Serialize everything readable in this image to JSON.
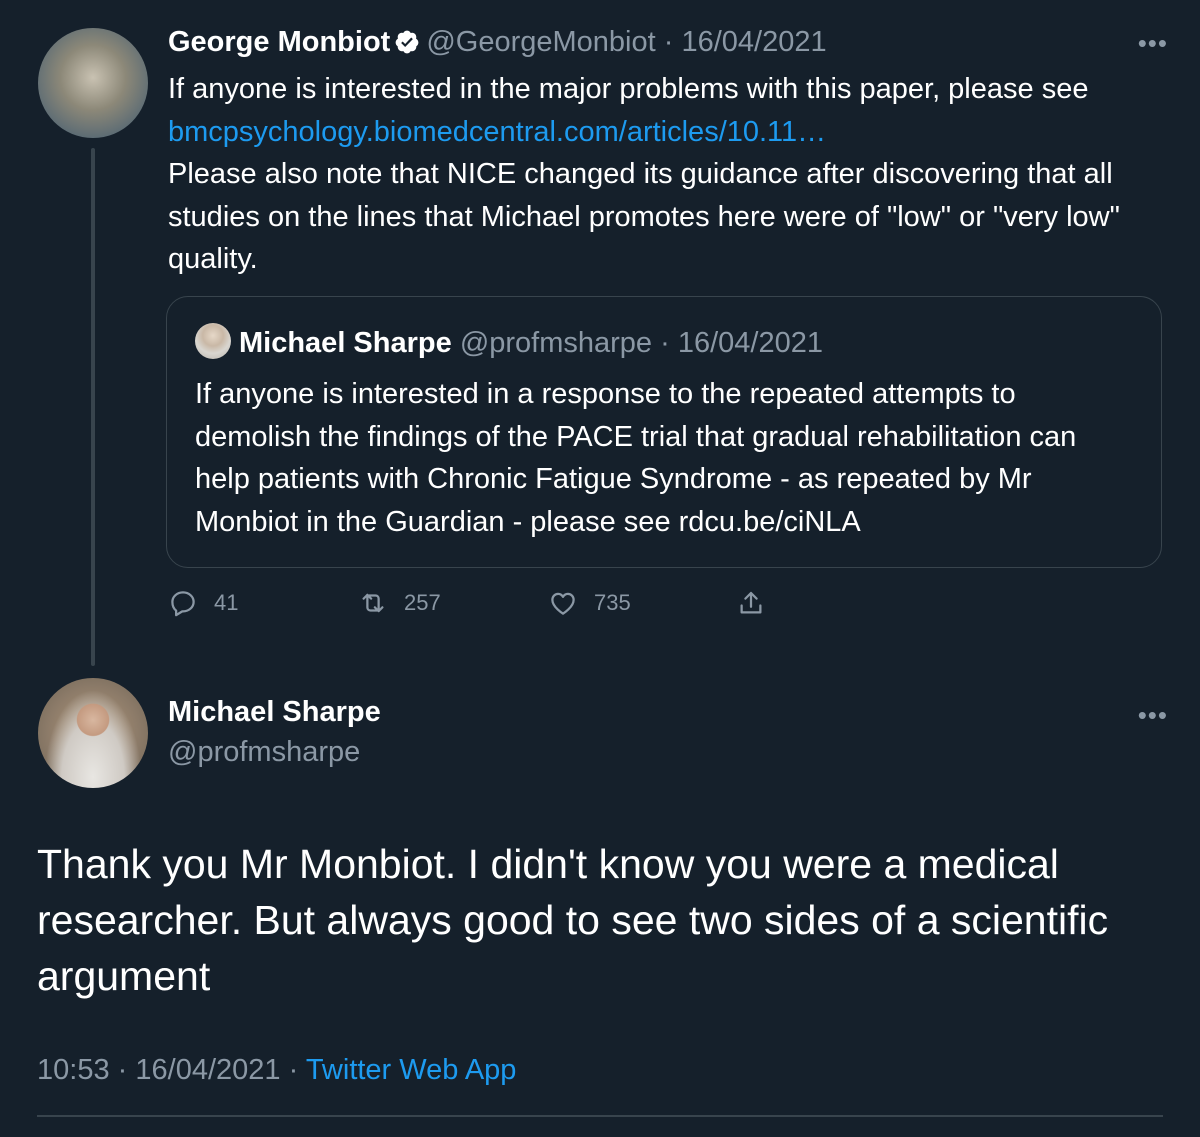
{
  "parent_tweet": {
    "author_name": "George Monbiot",
    "author_handle": "@GeorgeMonbiot",
    "separator": "·",
    "date": "16/04/2021",
    "text_line1": "If anyone is interested in the major problems with this paper, please see",
    "link_text": "bmcpsychology.biomedcentral.com/articles/10.11…",
    "text_rest": "Please also note that NICE changed its guidance after discovering that all studies on the lines that Michael promotes here were of \"low\" or \"very low\" quality.",
    "more_label": "•••"
  },
  "quoted_tweet": {
    "author_name": "Michael Sharpe",
    "author_handle": "@profmsharpe",
    "separator": "·",
    "date": "16/04/2021",
    "text": "If anyone is interested in a response to the repeated attempts to demolish the findings of the PACE trial that gradual rehabilitation can help patients with Chronic Fatigue Syndrome  - as repeated by Mr Monbiot in the Guardian -  please see rdcu.be/ciNLA"
  },
  "actions": {
    "reply_count": "41",
    "retweet_count": "257",
    "like_count": "735"
  },
  "main_tweet": {
    "author_name": "Michael Sharpe",
    "author_handle": "@profmsharpe",
    "more_label": "•••",
    "text": "Thank you Mr Monbiot.  I didn't know you were a medical researcher. But always good to see two sides of a scientific argument",
    "time": "10:53",
    "separator1": "·",
    "date": "16/04/2021",
    "separator2": "·",
    "source": "Twitter Web App"
  },
  "colors": {
    "background": "#15202b",
    "text": "#ffffff",
    "muted": "#8b98a5",
    "link": "#1d9bf0",
    "border": "#38444d"
  },
  "icons": {
    "verified": "verified-badge-icon",
    "reply": "reply-icon",
    "retweet": "retweet-icon",
    "like": "heart-icon",
    "share": "share-icon",
    "more": "more-icon"
  }
}
